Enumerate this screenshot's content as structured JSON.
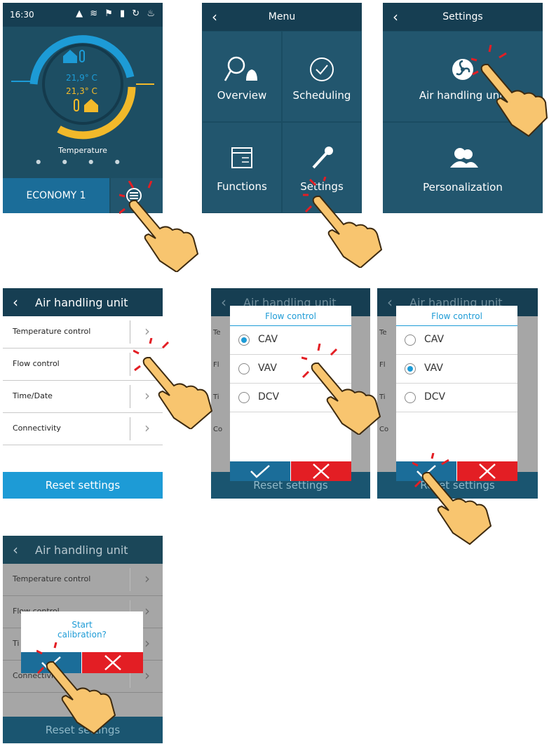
{
  "home": {
    "time": "16:30",
    "temp_in": "21,9° C",
    "temp_out": "21,3° C",
    "label": "Temperature",
    "mode": "ECONOMY 1"
  },
  "menu": {
    "title": "Menu",
    "items": [
      "Overview",
      "Scheduling",
      "Functions",
      "Settings"
    ]
  },
  "settings": {
    "title": "Settings",
    "items": [
      "Air handling unit",
      "Personalization"
    ]
  },
  "ahu": {
    "title": "Air handling unit",
    "rows": [
      "Temperature control",
      "Flow control",
      "Time/Date",
      "Connectivity"
    ],
    "reset": "Reset settings"
  },
  "flow": {
    "title": "Flow control",
    "options": [
      "CAV",
      "VAV",
      "DCV"
    ],
    "bg_title": "Air handling unit",
    "peek": [
      "Te",
      "Fl",
      "Ti",
      "Co"
    ]
  },
  "calib": {
    "question_line1": "Start",
    "question_line2": "calibration?",
    "peek": [
      "Ti",
      "Connectivity"
    ]
  },
  "colors": {
    "header": "#163e52",
    "panel": "#1d4e63",
    "accent": "#1d9bd6",
    "cancel": "#e31e24",
    "hand": "#f8c56f"
  }
}
